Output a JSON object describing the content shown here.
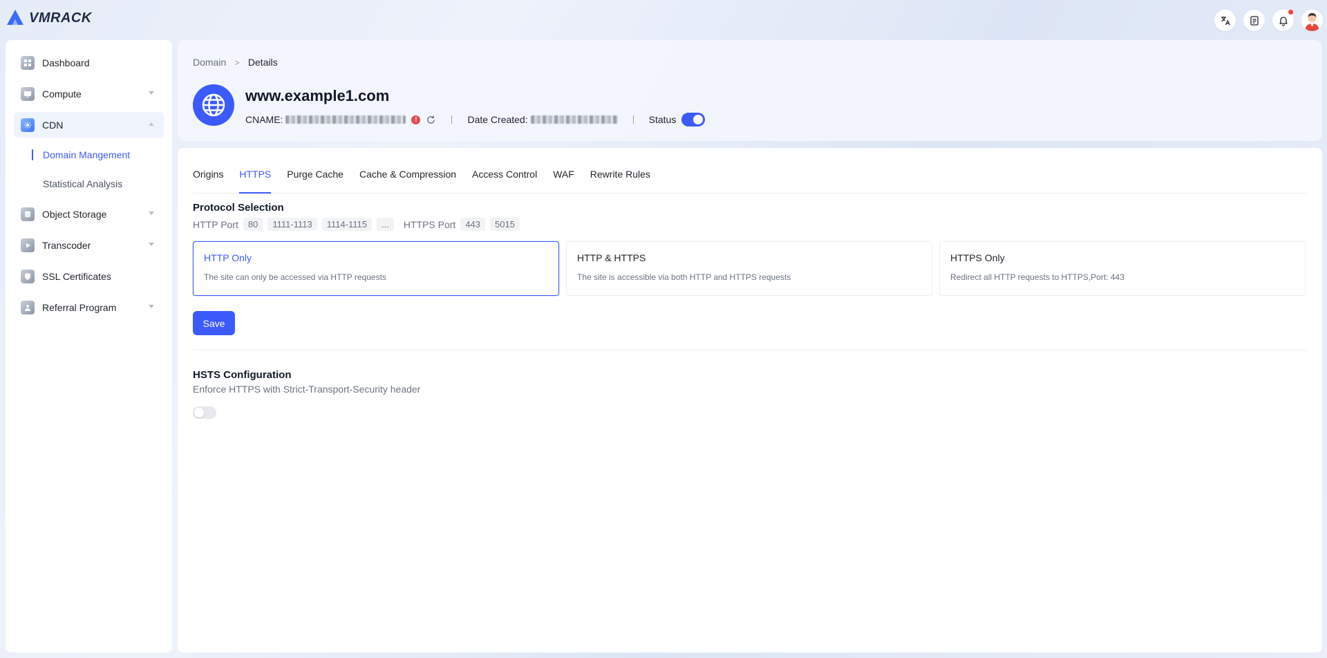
{
  "app": {
    "brand": "VMRACK",
    "accent_color": "#3b5bfd"
  },
  "topbar": {
    "icons": [
      "translate-icon",
      "document-icon",
      "bell-icon",
      "avatar"
    ]
  },
  "sidebar": {
    "items": [
      {
        "label": "Dashboard",
        "icon": "dashboard-icon"
      },
      {
        "label": "Compute",
        "icon": "compute-icon",
        "expandable": true
      },
      {
        "label": "CDN",
        "icon": "cdn-icon",
        "expanded": true,
        "active": true,
        "children": [
          {
            "label": "Domain Mangement",
            "active": true
          },
          {
            "label": "Statistical Analysis"
          }
        ]
      },
      {
        "label": "Object Storage",
        "icon": "storage-icon",
        "expandable": true
      },
      {
        "label": "Transcoder",
        "icon": "transcoder-icon",
        "expandable": true
      },
      {
        "label": "SSL Certificates",
        "icon": "ssl-icon"
      },
      {
        "label": "Referral Program",
        "icon": "referral-icon",
        "expandable": true
      }
    ]
  },
  "breadcrumb": {
    "parent": "Domain",
    "separator": ">",
    "current": "Details"
  },
  "domain": {
    "name": "www.example1.com",
    "cname_label": "CNAME:",
    "date_created_label": "Date Created:",
    "status_label": "Status",
    "status_enabled": true
  },
  "tabs": [
    "Origins",
    "HTTPS",
    "Purge Cache",
    "Cache & Compression",
    "Access Control",
    "WAF",
    "Rewrite Rules"
  ],
  "active_tab": "HTTPS",
  "protocol": {
    "title": "Protocol Selection",
    "http_port_label": "HTTP Port",
    "http_ports": [
      "80",
      "1111-1113",
      "1114-1115",
      "..."
    ],
    "https_port_label": "HTTPS Port",
    "https_ports": [
      "443",
      "5015"
    ],
    "options": [
      {
        "title": "HTTP Only",
        "desc": "The site can only be accessed via HTTP requests",
        "selected": true
      },
      {
        "title": "HTTP & HTTPS",
        "desc": "The site is accessible via both HTTP and HTTPS requests",
        "selected": false
      },
      {
        "title": "HTTPS Only",
        "desc": "Redirect all HTTP requests to HTTPS,Port: 443",
        "selected": false
      }
    ],
    "save_label": "Save"
  },
  "hsts": {
    "title": "HSTS Configuration",
    "desc": "Enforce HTTPS with Strict-Transport-Security header",
    "enabled": false
  }
}
